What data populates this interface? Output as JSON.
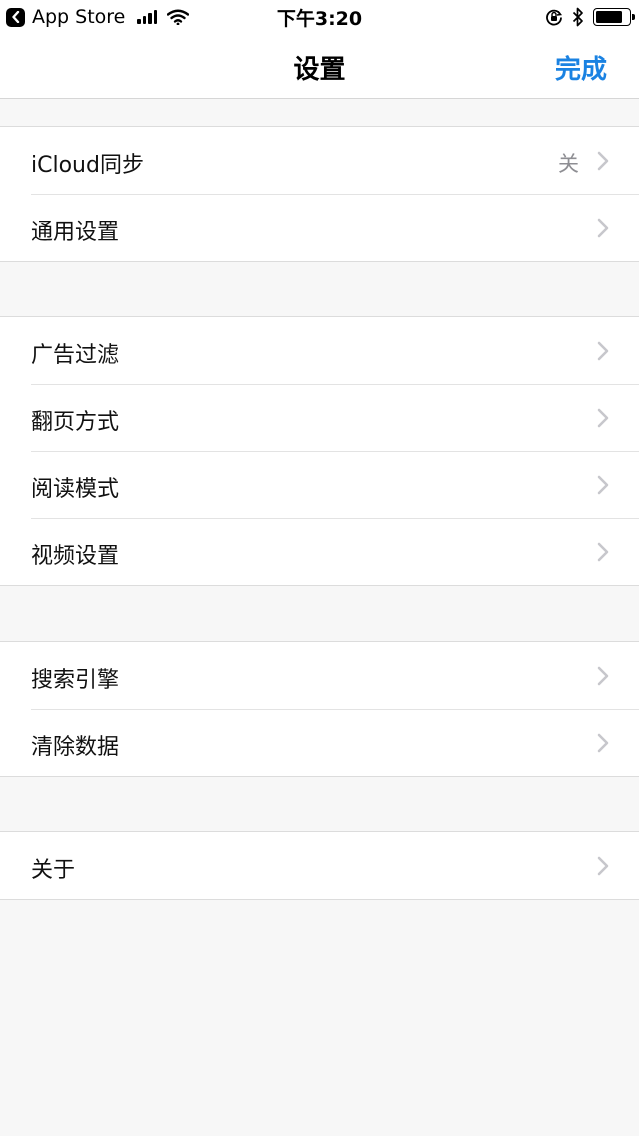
{
  "status_bar": {
    "back_app": "App Store",
    "time": "下午3:20"
  },
  "nav": {
    "title": "设置",
    "done_label": "完成"
  },
  "groups": [
    {
      "items": [
        {
          "label": "iCloud同步",
          "value": "关"
        },
        {
          "label": "通用设置"
        }
      ]
    },
    {
      "items": [
        {
          "label": "广告过滤"
        },
        {
          "label": "翻页方式"
        },
        {
          "label": "阅读模式"
        },
        {
          "label": "视频设置"
        }
      ]
    },
    {
      "items": [
        {
          "label": "搜索引擎"
        },
        {
          "label": "清除数据"
        }
      ]
    },
    {
      "items": [
        {
          "label": "关于"
        }
      ]
    }
  ],
  "icons": {
    "back": "back-arrow-icon",
    "signal": "signal-bars-icon",
    "wifi": "wifi-icon",
    "rotation_lock": "rotation-lock-icon",
    "bluetooth": "bluetooth-icon",
    "battery": "battery-icon",
    "chevron": "chevron-right-icon"
  },
  "colors": {
    "accent": "#1a82e2",
    "background": "#f7f7f7",
    "value_gray": "#8e8e93",
    "chevron_gray": "#c7c7cc"
  },
  "battery_level": 0.85
}
